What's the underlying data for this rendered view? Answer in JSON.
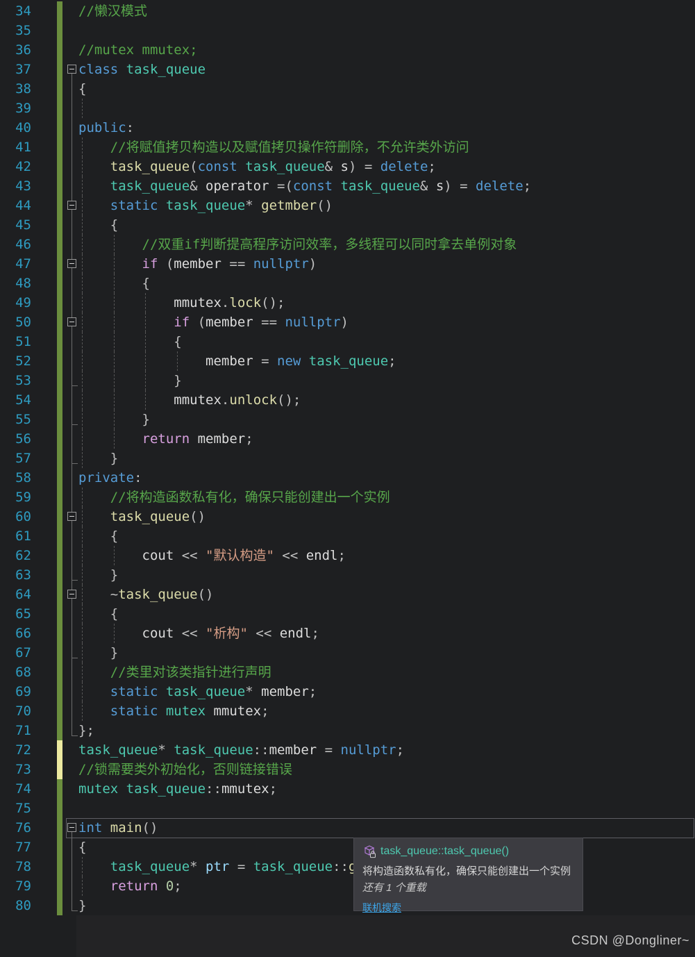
{
  "palette": {
    "kw": "#569cd6",
    "ctl": "#d8a0df",
    "typ": "#4ec9b0",
    "fn": "#dcdcaa",
    "str": "#d69d85",
    "com": "#57a64a",
    "pln": "#dcdcdc",
    "pun": "#c0c0c0",
    "var": "#9cdcfe",
    "num": "#b5cea8",
    "lineNumber": "#2e9bc0",
    "changeBarGreen": "#6b8e3e",
    "changeBarYellow": "#ece9a0"
  },
  "editor": {
    "lines": [
      {
        "n": 34,
        "bar": "green",
        "fold": null,
        "guides": [],
        "ind": 0,
        "toks": [
          [
            "com",
            "//懒汉模式"
          ]
        ]
      },
      {
        "n": 35,
        "bar": "green",
        "fold": null,
        "guides": [],
        "ind": 0,
        "toks": []
      },
      {
        "n": 36,
        "bar": "green",
        "fold": null,
        "guides": [],
        "ind": 0,
        "toks": [
          [
            "com",
            "//mutex mmutex;"
          ]
        ]
      },
      {
        "n": 37,
        "bar": "green",
        "fold": "minus-top",
        "guides": [],
        "ind": 0,
        "toks": [
          [
            "kw",
            "class "
          ],
          [
            "typ",
            "task_queue"
          ]
        ]
      },
      {
        "n": 38,
        "bar": "green",
        "fold": "line",
        "guides": [],
        "ind": 0,
        "toks": [
          [
            "pun",
            "{"
          ]
        ]
      },
      {
        "n": 39,
        "bar": "green",
        "fold": "line",
        "guides": [
          0
        ],
        "ind": 0,
        "toks": []
      },
      {
        "n": 40,
        "bar": "green",
        "fold": "line",
        "guides": [],
        "ind": 0,
        "toks": [
          [
            "kw",
            "public"
          ],
          [
            "pun",
            ":"
          ]
        ]
      },
      {
        "n": 41,
        "bar": "green",
        "fold": "line",
        "guides": [
          0
        ],
        "ind": 4,
        "toks": [
          [
            "com",
            "//将赋值拷贝构造以及赋值拷贝操作符删除，不允许类外访问"
          ]
        ]
      },
      {
        "n": 42,
        "bar": "green",
        "fold": "line",
        "guides": [
          0
        ],
        "ind": 4,
        "toks": [
          [
            "fn",
            "task_queue"
          ],
          [
            "pun",
            "("
          ],
          [
            "kw",
            "const "
          ],
          [
            "typ",
            "task_queue"
          ],
          [
            "pun",
            "& "
          ],
          [
            "pln",
            "s"
          ],
          [
            "pun",
            ") = "
          ],
          [
            "kw",
            "delete"
          ],
          [
            "pun",
            ";"
          ]
        ]
      },
      {
        "n": 43,
        "bar": "green",
        "fold": "line",
        "guides": [
          0
        ],
        "ind": 4,
        "toks": [
          [
            "typ",
            "task_queue"
          ],
          [
            "pun",
            "& "
          ],
          [
            "pln",
            "operator "
          ],
          [
            "pun",
            "=("
          ],
          [
            "kw",
            "const "
          ],
          [
            "typ",
            "task_queue"
          ],
          [
            "pun",
            "& "
          ],
          [
            "pln",
            "s"
          ],
          [
            "pun",
            ") = "
          ],
          [
            "kw",
            "delete"
          ],
          [
            "pun",
            ";"
          ]
        ]
      },
      {
        "n": 44,
        "bar": "green",
        "fold": "minus",
        "guides": [
          0
        ],
        "ind": 4,
        "toks": [
          [
            "kw",
            "static "
          ],
          [
            "typ",
            "task_queue"
          ],
          [
            "pun",
            "* "
          ],
          [
            "fn",
            "getmber"
          ],
          [
            "pun",
            "()"
          ]
        ]
      },
      {
        "n": 45,
        "bar": "green",
        "fold": "line",
        "guides": [
          0
        ],
        "ind": 4,
        "toks": [
          [
            "pun",
            "{"
          ]
        ]
      },
      {
        "n": 46,
        "bar": "green",
        "fold": "line",
        "guides": [
          0,
          1
        ],
        "ind": 8,
        "toks": [
          [
            "com",
            "//双重if判断提高程序访问效率，多线程可以同时拿去单例对象"
          ]
        ]
      },
      {
        "n": 47,
        "bar": "green",
        "fold": "minus",
        "guides": [
          0,
          1
        ],
        "ind": 8,
        "toks": [
          [
            "ctl",
            "if "
          ],
          [
            "pun",
            "("
          ],
          [
            "pln",
            "member "
          ],
          [
            "pun",
            "== "
          ],
          [
            "kw",
            "nullptr"
          ],
          [
            "pun",
            ")"
          ]
        ]
      },
      {
        "n": 48,
        "bar": "green",
        "fold": "line",
        "guides": [
          0,
          1
        ],
        "ind": 8,
        "toks": [
          [
            "pun",
            "{"
          ]
        ]
      },
      {
        "n": 49,
        "bar": "green",
        "fold": "line",
        "guides": [
          0,
          1,
          2
        ],
        "ind": 12,
        "toks": [
          [
            "pln",
            "mmutex"
          ],
          [
            "pun",
            "."
          ],
          [
            "fn",
            "lock"
          ],
          [
            "pun",
            "();"
          ]
        ]
      },
      {
        "n": 50,
        "bar": "green",
        "fold": "minus",
        "guides": [
          0,
          1,
          2
        ],
        "ind": 12,
        "toks": [
          [
            "ctl",
            "if "
          ],
          [
            "pun",
            "("
          ],
          [
            "pln",
            "member "
          ],
          [
            "pun",
            "== "
          ],
          [
            "kw",
            "nullptr"
          ],
          [
            "pun",
            ")"
          ]
        ]
      },
      {
        "n": 51,
        "bar": "green",
        "fold": "line",
        "guides": [
          0,
          1,
          2
        ],
        "ind": 12,
        "toks": [
          [
            "pun",
            "{"
          ]
        ]
      },
      {
        "n": 52,
        "bar": "green",
        "fold": "line",
        "guides": [
          0,
          1,
          2,
          3
        ],
        "ind": 16,
        "toks": [
          [
            "pln",
            "member "
          ],
          [
            "pun",
            "= "
          ],
          [
            "kw",
            "new "
          ],
          [
            "typ",
            "task_queue"
          ],
          [
            "pun",
            ";"
          ]
        ]
      },
      {
        "n": 53,
        "bar": "green",
        "fold": "tick",
        "guides": [
          0,
          1,
          2
        ],
        "ind": 12,
        "toks": [
          [
            "pun",
            "}"
          ]
        ]
      },
      {
        "n": 54,
        "bar": "green",
        "fold": "line",
        "guides": [
          0,
          1,
          2
        ],
        "ind": 12,
        "toks": [
          [
            "pln",
            "mmutex"
          ],
          [
            "pun",
            "."
          ],
          [
            "fn",
            "unlock"
          ],
          [
            "pun",
            "();"
          ]
        ]
      },
      {
        "n": 55,
        "bar": "green",
        "fold": "tick",
        "guides": [
          0,
          1
        ],
        "ind": 8,
        "toks": [
          [
            "pun",
            "}"
          ]
        ]
      },
      {
        "n": 56,
        "bar": "green",
        "fold": "line",
        "guides": [
          0,
          1
        ],
        "ind": 8,
        "toks": [
          [
            "ctl",
            "return "
          ],
          [
            "pln",
            "member"
          ],
          [
            "pun",
            ";"
          ]
        ]
      },
      {
        "n": 57,
        "bar": "green",
        "fold": "tick",
        "guides": [
          0
        ],
        "ind": 4,
        "toks": [
          [
            "pun",
            "}"
          ]
        ]
      },
      {
        "n": 58,
        "bar": "green",
        "fold": "line",
        "guides": [],
        "ind": 0,
        "toks": [
          [
            "kw",
            "private"
          ],
          [
            "pun",
            ":"
          ]
        ]
      },
      {
        "n": 59,
        "bar": "green",
        "fold": "line",
        "guides": [
          0
        ],
        "ind": 4,
        "toks": [
          [
            "com",
            "//将构造函数私有化，确保只能创建出一个实例"
          ]
        ]
      },
      {
        "n": 60,
        "bar": "green",
        "fold": "minus",
        "guides": [
          0
        ],
        "ind": 4,
        "toks": [
          [
            "fn",
            "task_queue"
          ],
          [
            "pun",
            "()"
          ]
        ]
      },
      {
        "n": 61,
        "bar": "green",
        "fold": "line",
        "guides": [
          0
        ],
        "ind": 4,
        "toks": [
          [
            "pun",
            "{"
          ]
        ]
      },
      {
        "n": 62,
        "bar": "green",
        "fold": "line",
        "guides": [
          0,
          1
        ],
        "ind": 8,
        "toks": [
          [
            "pln",
            "cout "
          ],
          [
            "pun",
            "<< "
          ],
          [
            "str",
            "\"默认构造\" "
          ],
          [
            "pun",
            "<< "
          ],
          [
            "pln",
            "endl"
          ],
          [
            "pun",
            ";"
          ]
        ]
      },
      {
        "n": 63,
        "bar": "green",
        "fold": "tick",
        "guides": [
          0
        ],
        "ind": 4,
        "toks": [
          [
            "pun",
            "}"
          ]
        ]
      },
      {
        "n": 64,
        "bar": "green",
        "fold": "minus",
        "guides": [
          0
        ],
        "ind": 4,
        "toks": [
          [
            "pun",
            "~"
          ],
          [
            "fn",
            "task_queue"
          ],
          [
            "pun",
            "()"
          ]
        ]
      },
      {
        "n": 65,
        "bar": "green",
        "fold": "line",
        "guides": [
          0
        ],
        "ind": 4,
        "toks": [
          [
            "pun",
            "{"
          ]
        ]
      },
      {
        "n": 66,
        "bar": "green",
        "fold": "line",
        "guides": [
          0,
          1
        ],
        "ind": 8,
        "toks": [
          [
            "pln",
            "cout "
          ],
          [
            "pun",
            "<< "
          ],
          [
            "str",
            "\"析构\" "
          ],
          [
            "pun",
            "<< "
          ],
          [
            "pln",
            "endl"
          ],
          [
            "pun",
            ";"
          ]
        ]
      },
      {
        "n": 67,
        "bar": "green",
        "fold": "tick",
        "guides": [
          0
        ],
        "ind": 4,
        "toks": [
          [
            "pun",
            "}"
          ]
        ]
      },
      {
        "n": 68,
        "bar": "green",
        "fold": "line",
        "guides": [
          0
        ],
        "ind": 4,
        "toks": [
          [
            "com",
            "//类里对该类指针进行声明"
          ]
        ]
      },
      {
        "n": 69,
        "bar": "green",
        "fold": "line",
        "guides": [
          0
        ],
        "ind": 4,
        "toks": [
          [
            "kw",
            "static "
          ],
          [
            "typ",
            "task_queue"
          ],
          [
            "pun",
            "* "
          ],
          [
            "pln",
            "member"
          ],
          [
            "pun",
            ";"
          ]
        ]
      },
      {
        "n": 70,
        "bar": "green",
        "fold": "line",
        "guides": [
          0
        ],
        "ind": 4,
        "toks": [
          [
            "kw",
            "static "
          ],
          [
            "typ",
            "mutex"
          ],
          [
            "pln",
            " mmutex"
          ],
          [
            "pun",
            ";"
          ]
        ]
      },
      {
        "n": 71,
        "bar": "green",
        "fold": "corner",
        "guides": [],
        "ind": 0,
        "toks": [
          [
            "pun",
            "};"
          ]
        ]
      },
      {
        "n": 72,
        "bar": "yellow",
        "fold": null,
        "guides": [],
        "ind": 0,
        "toks": [
          [
            "typ",
            "task_queue"
          ],
          [
            "pun",
            "* "
          ],
          [
            "typ",
            "task_queue"
          ],
          [
            "pun",
            "::"
          ],
          [
            "pln",
            "member "
          ],
          [
            "pun",
            "= "
          ],
          [
            "kw",
            "nullptr"
          ],
          [
            "pun",
            ";"
          ]
        ]
      },
      {
        "n": 73,
        "bar": "yellow",
        "fold": null,
        "guides": [],
        "ind": 0,
        "toks": [
          [
            "com",
            "//锁需要类外初始化，否则链接错误"
          ]
        ]
      },
      {
        "n": 74,
        "bar": "green",
        "fold": null,
        "guides": [],
        "ind": 0,
        "toks": [
          [
            "typ",
            "mutex"
          ],
          [
            "pln",
            " "
          ],
          [
            "typ",
            "task_queue"
          ],
          [
            "pun",
            "::"
          ],
          [
            "pln",
            "mmutex"
          ],
          [
            "pun",
            ";"
          ]
        ]
      },
      {
        "n": 75,
        "bar": "green",
        "fold": null,
        "guides": [],
        "ind": 0,
        "toks": []
      },
      {
        "n": 76,
        "bar": "green",
        "fold": "minus-top",
        "guides": [],
        "ind": 0,
        "cur": true,
        "toks": [
          [
            "kw",
            "int "
          ],
          [
            "fn",
            "main"
          ],
          [
            "pun",
            "()"
          ]
        ]
      },
      {
        "n": 77,
        "bar": "green",
        "fold": "line",
        "guides": [],
        "ind": 0,
        "toks": [
          [
            "pun",
            "{"
          ]
        ]
      },
      {
        "n": 78,
        "bar": "green",
        "fold": "line",
        "guides": [
          0
        ],
        "ind": 4,
        "toks": [
          [
            "typ",
            "task_queue"
          ],
          [
            "pun",
            "* "
          ],
          [
            "var",
            "ptr "
          ],
          [
            "pun",
            "= "
          ],
          [
            "typ",
            "task_queue"
          ],
          [
            "pun",
            "::"
          ],
          [
            "fn",
            "g"
          ]
        ]
      },
      {
        "n": 79,
        "bar": "green",
        "fold": "line",
        "guides": [
          0
        ],
        "ind": 4,
        "toks": [
          [
            "ctl",
            "return "
          ],
          [
            "num",
            "0"
          ],
          [
            "pun",
            ";"
          ]
        ]
      },
      {
        "n": 80,
        "bar": "green",
        "fold": "corner",
        "guides": [],
        "ind": 0,
        "toks": [
          [
            "pun",
            "}"
          ]
        ]
      }
    ]
  },
  "tooltip": {
    "symbol": "task_queue::task_queue()",
    "description": "将构造函数私有化，确保只能创建出一个实例",
    "overloads": "还有 1 个重载",
    "link_label": "联机搜索"
  },
  "footer": {
    "watermark": "CSDN @Dongliner~"
  }
}
